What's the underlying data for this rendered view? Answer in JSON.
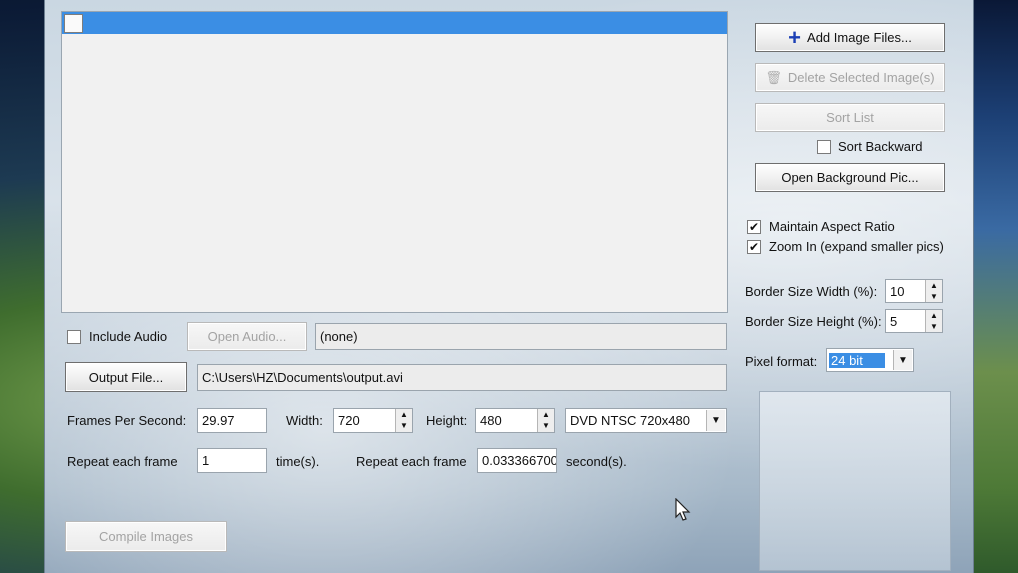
{
  "buttons": {
    "add_images": "Add Image Files...",
    "delete_selected": "Delete Selected Image(s)",
    "sort_list": "Sort List",
    "open_background": "Open Background Pic...",
    "open_audio": "Open Audio...",
    "output_file": "Output File...",
    "compile": "Compile Images"
  },
  "options": {
    "sort_backward": {
      "label": "Sort Backward",
      "checked": false
    },
    "maintain_aspect": {
      "label": "Maintain Aspect Ratio",
      "checked": true
    },
    "zoom_in": {
      "label": "Zoom In (expand smaller pics)",
      "checked": true
    },
    "include_audio": {
      "label": "Include Audio",
      "checked": false
    }
  },
  "border": {
    "width_label": "Border Size Width (%):",
    "width_value": "10",
    "height_label": "Border Size Height (%):",
    "height_value": "5"
  },
  "pixel_format": {
    "label": "Pixel format:",
    "value": "24 bit"
  },
  "audio_path": "(none)",
  "output_path": "C:\\Users\\HZ\\Documents\\output.avi",
  "video": {
    "fps_label": "Frames Per Second:",
    "fps_value": "29.97",
    "width_label": "Width:",
    "width_value": "720",
    "height_label": "Height:",
    "height_value": "480",
    "preset_value": "DVD NTSC 720x480"
  },
  "repeat": {
    "frames_label": "Repeat each frame",
    "frames_value": "1",
    "frames_unit": "time(s).",
    "seconds_label": "Repeat each frame",
    "seconds_value": "0.033366700",
    "seconds_unit": "second(s)."
  },
  "colors": {
    "selection": "#3b8ee4",
    "add_icon": "#1b3fb5"
  }
}
